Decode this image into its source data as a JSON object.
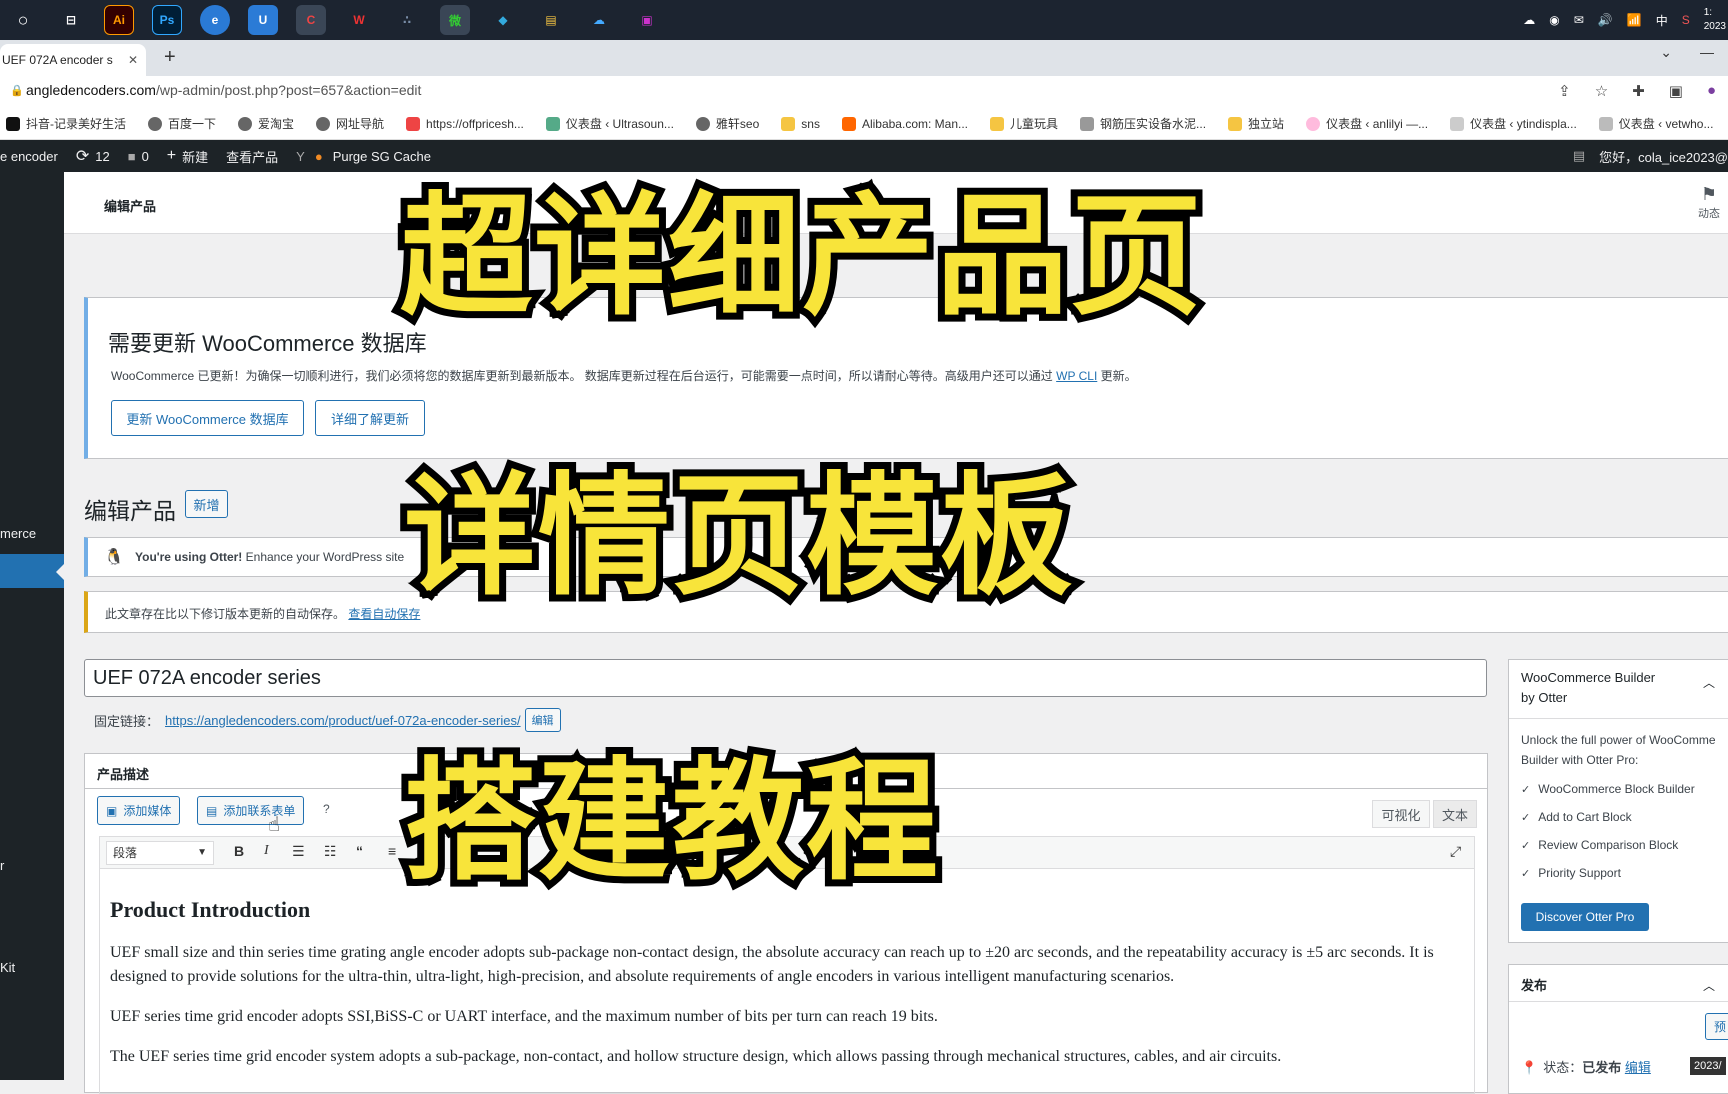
{
  "taskbar": {
    "apps": [
      "○",
      "⊟",
      "Ai",
      "Ps",
      "e",
      "U",
      "C",
      "W",
      "∴",
      "微",
      "◆",
      "▤",
      "☁",
      "▣"
    ],
    "tray": [
      "☁",
      "◉",
      "✉",
      "🔊",
      "📶",
      "中",
      "S"
    ],
    "clock": "1:",
    "date": "2023"
  },
  "browser": {
    "tab_title": "UEF 072A encoder s",
    "url_host": "angledencoders.com",
    "url_path": "/wp-admin/post.php?post=657&action=edit",
    "bookmarks": [
      "抖音-记录美好生活",
      "百度一下",
      "爱淘宝",
      "网址导航",
      "https://offpricesh...",
      "仪表盘 ‹ Ultrasoun...",
      "雅轩seo",
      "sns",
      "Alibaba.com: Man...",
      "儿童玩具",
      "钢筋压实设备水泥...",
      "独立站",
      "仪表盘 ‹ anlilyi —...",
      "仪表盘 ‹ ytindispla...",
      "仪表盘 ‹ vetwho..."
    ]
  },
  "adminbar": {
    "site": "e encoder",
    "updates": "12",
    "comments": "0",
    "new": "新建",
    "view": "查看产品",
    "purge": "Purge SG Cache",
    "greeting": "您好，cola_ice2023@"
  },
  "sidebar": {
    "items": [
      "merce",
      "r",
      "Kit"
    ]
  },
  "header": {
    "title": "编辑产品",
    "activity": "动态"
  },
  "wc_notice": {
    "heading": "需要更新 WooCommerce 数据库",
    "text": "WooCommerce 已更新！为确保一切顺利进行，我们必须将您的数据库更新到最新版本。 数据库更新过程在后台运行，可能需要一点时间，所以请耐心等待。高级用户还可以通过",
    "link": "WP CLI",
    "text_end": "更新。",
    "btn_update": "更新 WooCommerce 数据库",
    "btn_learn": "详细了解更新"
  },
  "page": {
    "h1": "编辑产品",
    "add_new": "新增",
    "otter_bold": "You're using Otter!",
    "otter_text": "Enhance your WordPress site",
    "autosave_text": "此文章存在比以下修订版本更新的自动保存。",
    "autosave_link": "查看自动保存",
    "post_title": "UEF 072A encoder series",
    "permalink_label": "固定链接：",
    "permalink_url": "https://angledencoders.com/product/uef-072a-encoder-series/",
    "permalink_edit": "编辑"
  },
  "editor": {
    "box_title": "产品描述",
    "add_media": "添加媒体",
    "add_form": "添加联系表单",
    "tab_visual": "可视化",
    "tab_text": "文本",
    "format": "段落",
    "heading": "Product Introduction",
    "p1": "UEF small size and thin series time grating angle encoder adopts sub-package non-contact design, the absolute accuracy can reach up to ±20 arc seconds, and the repeatability accuracy is ±5 arc seconds. It is designed to provide solutions for the ultra-thin, ultra-light, high-precision, and absolute requirements of angle encoders in various intelligent manufacturing scenarios.",
    "p2": "UEF series time grid encoder adopts SSI,BiSS-C or UART interface, and the maximum number of bits per turn can reach 19 bits.",
    "p3": "The UEF series time grid encoder system adopts a sub-package, non-contact, and hollow structure design, which allows passing through mechanical structures, cables, and air circuits."
  },
  "otter_box": {
    "title1": "WooCommerce Builder",
    "title2": "by Otter",
    "desc1": "Unlock the full power of WooComme",
    "desc2": "Builder with Otter Pro:",
    "features": [
      "WooCommerce Block Builder",
      "Add to Cart Block",
      "Review Comparison Block",
      "Priority Support"
    ],
    "cta": "Discover Otter Pro"
  },
  "publish_box": {
    "title": "发布",
    "preview": "预",
    "status_label": "状态：",
    "status_value": "已发布",
    "status_edit": "编辑"
  },
  "overlay": {
    "line1": "超详细产品页",
    "line2": "详情页模板",
    "line3": "搭建教程"
  },
  "time_chip": "2023/"
}
